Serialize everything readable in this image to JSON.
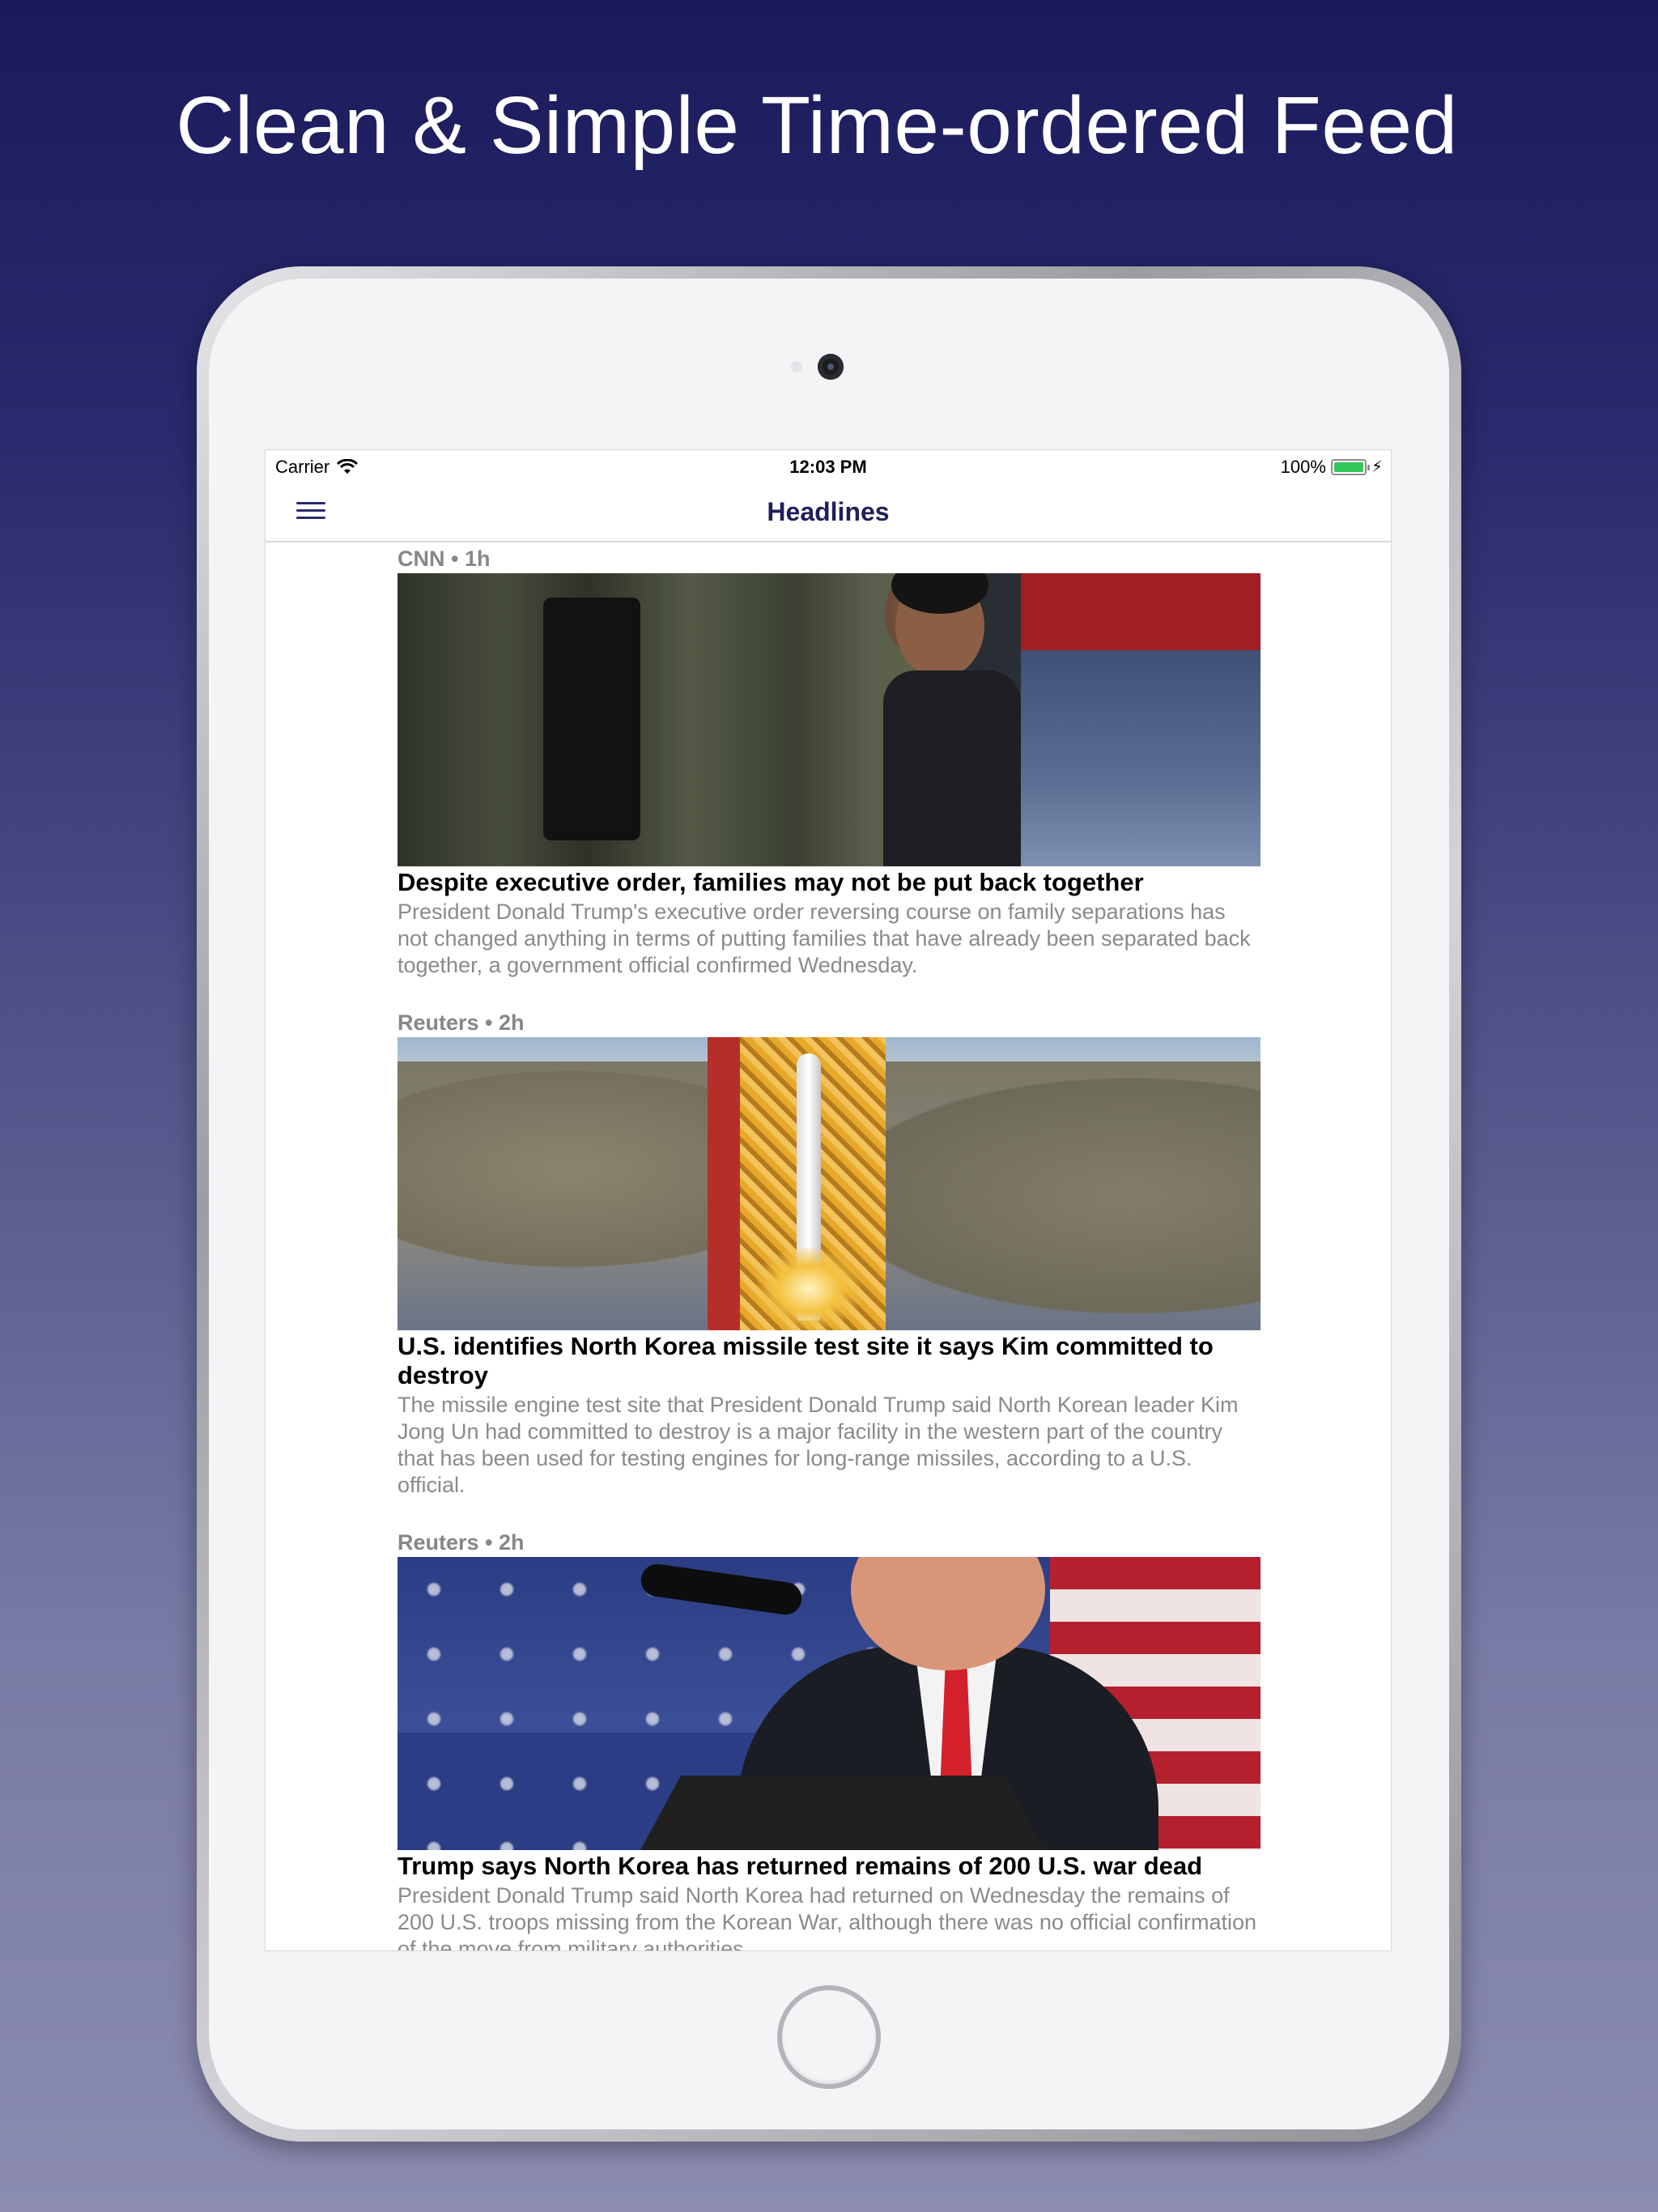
{
  "promo": {
    "title": "Clean & Simple Time-ordered Feed"
  },
  "status_bar": {
    "carrier": "Carrier",
    "time": "12:03 PM",
    "battery": "100%"
  },
  "nav": {
    "title": "Headlines",
    "menu_icon": "hamburger-menu-icon"
  },
  "articles": [
    {
      "meta": "CNN • 1h",
      "headline": "Despite executive order, families may not be put back together",
      "summary": "President Donald Trump's executive order reversing course on family separations has not changed anything in terms of putting families that have already been separated back together, a government official confirmed Wednesday."
    },
    {
      "meta": "Reuters • 2h",
      "headline": "U.S. identifies North Korea missile test site it says Kim committed to destroy",
      "summary": "The missile engine test site that President Donald Trump said North Korean leader Kim Jong Un had committed to destroy is a major facility in the western part of the country that has been used for testing engines for long-range missiles, according to a U.S. official."
    },
    {
      "meta": "Reuters • 2h",
      "headline": "Trump says North Korea has returned remains of 200 U.S. war dead",
      "summary": "President Donald Trump said North Korea had returned on Wednesday the remains of 200 U.S. troops missing from the Korean War, although there was no official confirmation of the move from military authorities."
    }
  ],
  "colors": {
    "background_top": "#1b1a5c",
    "background_bottom": "#8b8cb0",
    "nav_title": "#1f1f5c",
    "meta_text": "#86868b",
    "summary_text": "#8a8a8e",
    "battery_fill": "#34c759"
  }
}
